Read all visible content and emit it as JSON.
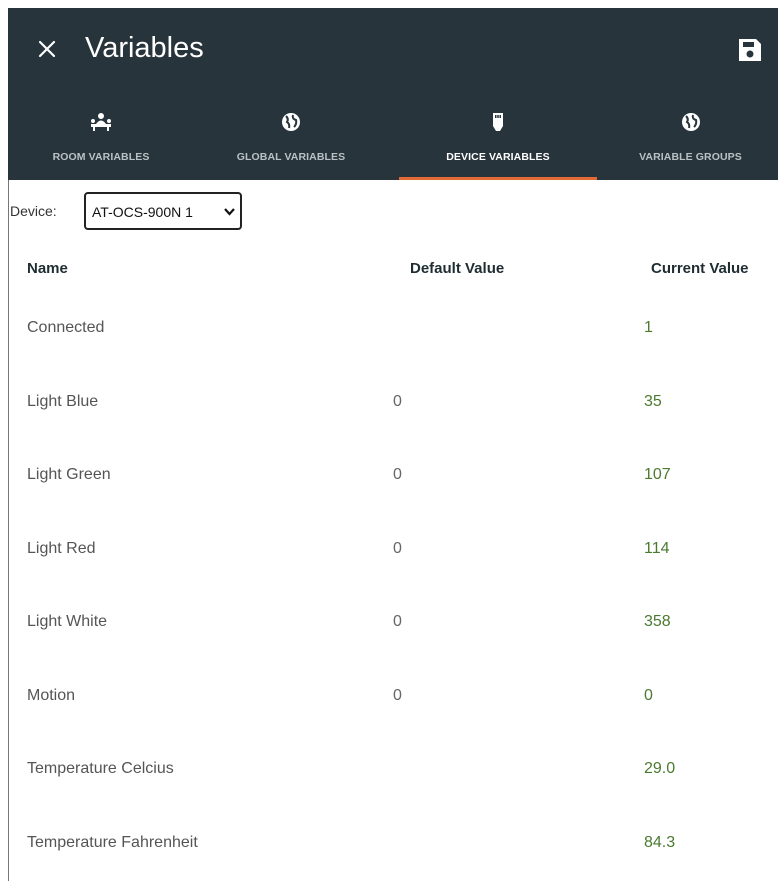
{
  "header": {
    "title": "Variables"
  },
  "tabs": [
    {
      "label": "ROOM VARIABLES",
      "icon": "room-users-icon"
    },
    {
      "label": "GLOBAL VARIABLES",
      "icon": "globe-icon"
    },
    {
      "label": "DEVICE VARIABLES",
      "icon": "device-icon",
      "active": true
    },
    {
      "label": "VARIABLE GROUPS",
      "icon": "globe-icon"
    }
  ],
  "device": {
    "label": "Device:",
    "selected": "AT-OCS-900N 1"
  },
  "table": {
    "columns": [
      "Name",
      "Default Value",
      "Current Value"
    ],
    "rows": [
      {
        "name": "Connected",
        "default": "",
        "current": "1"
      },
      {
        "name": "Light Blue",
        "default": "0",
        "current": "35"
      },
      {
        "name": "Light Green",
        "default": "0",
        "current": "107"
      },
      {
        "name": "Light Red",
        "default": "0",
        "current": "114"
      },
      {
        "name": "Light White",
        "default": "0",
        "current": "358"
      },
      {
        "name": "Motion",
        "default": "0",
        "current": "0"
      },
      {
        "name": "Temperature Celcius",
        "default": "",
        "current": "29.0"
      },
      {
        "name": "Temperature Fahrenheit",
        "default": "",
        "current": "84.3"
      }
    ]
  },
  "colors": {
    "header_bg": "#27343b",
    "active_underline": "#e36a34",
    "current_value": "#4a7a30"
  }
}
